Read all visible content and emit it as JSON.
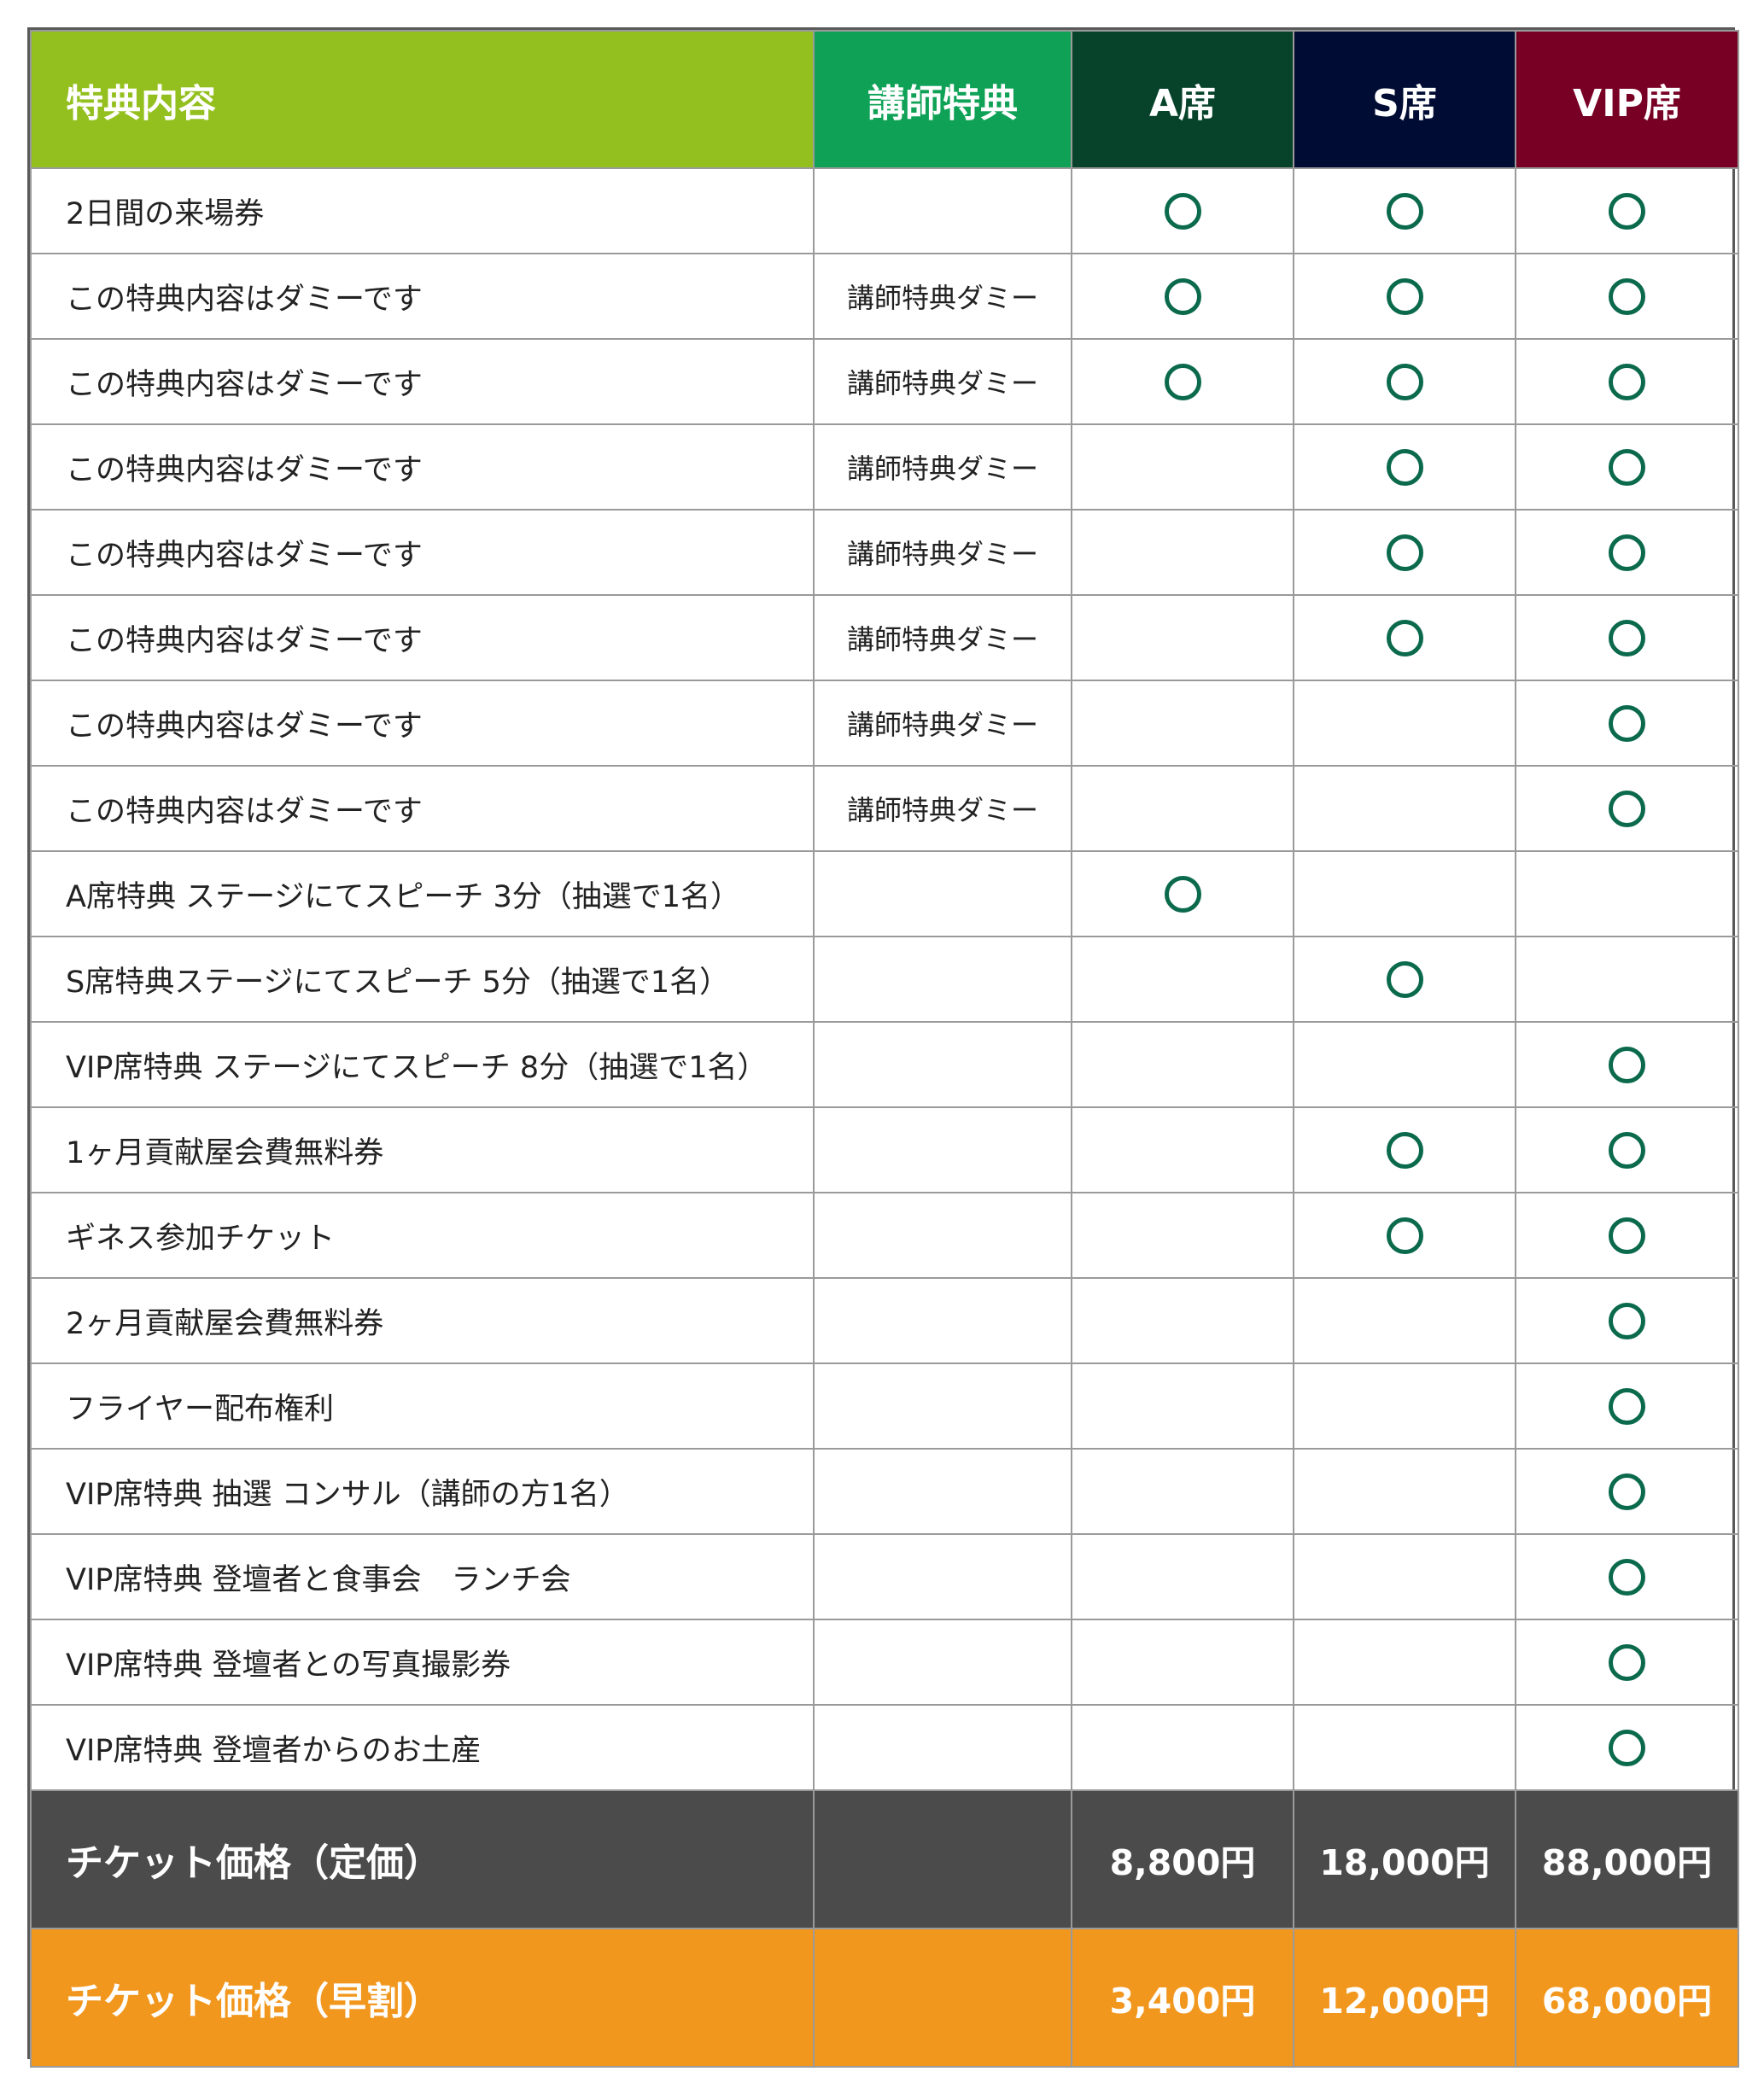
{
  "header": {
    "features": "特典内容",
    "instructor": "講師特典",
    "seat_a": "A席",
    "seat_s": "S席",
    "seat_vip": "VIP席"
  },
  "mark_symbol": "circle-mark",
  "colors": {
    "header_features": "#94c01f",
    "header_instructor": "#0fa257",
    "header_a": "#07432b",
    "header_s": "#000c33",
    "header_vip": "#790025",
    "circle": "#0b6a4c",
    "price_regular_bg": "#4b4b4b",
    "price_early_bg": "#f2971e"
  },
  "rows": [
    {
      "feature": "2日間の来場券",
      "instructor": "",
      "a": true,
      "s": true,
      "vip": true
    },
    {
      "feature": "この特典内容はダミーです",
      "instructor": "講師特典ダミー",
      "a": true,
      "s": true,
      "vip": true
    },
    {
      "feature": "この特典内容はダミーです",
      "instructor": "講師特典ダミー",
      "a": true,
      "s": true,
      "vip": true
    },
    {
      "feature": "この特典内容はダミーです",
      "instructor": "講師特典ダミー",
      "a": false,
      "s": true,
      "vip": true
    },
    {
      "feature": "この特典内容はダミーです",
      "instructor": "講師特典ダミー",
      "a": false,
      "s": true,
      "vip": true
    },
    {
      "feature": "この特典内容はダミーです",
      "instructor": "講師特典ダミー",
      "a": false,
      "s": true,
      "vip": true
    },
    {
      "feature": "この特典内容はダミーです",
      "instructor": "講師特典ダミー",
      "a": false,
      "s": false,
      "vip": true
    },
    {
      "feature": "この特典内容はダミーです",
      "instructor": "講師特典ダミー",
      "a": false,
      "s": false,
      "vip": true
    },
    {
      "feature": "A席特典 ステージにてスピーチ 3分（抽選で1名）",
      "instructor": "",
      "a": true,
      "s": false,
      "vip": false
    },
    {
      "feature": "S席特典ステージにてスピーチ 5分（抽選で1名）",
      "instructor": "",
      "a": false,
      "s": true,
      "vip": false
    },
    {
      "feature": "VIP席特典 ステージにてスピーチ 8分（抽選で1名）",
      "instructor": "",
      "a": false,
      "s": false,
      "vip": true
    },
    {
      "feature": "1ヶ月貢献屋会費無料券",
      "instructor": "",
      "a": false,
      "s": true,
      "vip": true
    },
    {
      "feature": "ギネス参加チケット",
      "instructor": "",
      "a": false,
      "s": true,
      "vip": true
    },
    {
      "feature": "2ヶ月貢献屋会費無料券",
      "instructor": "",
      "a": false,
      "s": false,
      "vip": true
    },
    {
      "feature": "フライヤー配布権利",
      "instructor": "",
      "a": false,
      "s": false,
      "vip": true
    },
    {
      "feature": "VIP席特典 抽選 コンサル（講師の方1名）",
      "instructor": "",
      "a": false,
      "s": false,
      "vip": true
    },
    {
      "feature": "VIP席特典 登壇者と食事会　ランチ会",
      "instructor": "",
      "a": false,
      "s": false,
      "vip": true
    },
    {
      "feature": "VIP席特典 登壇者との写真撮影券",
      "instructor": "",
      "a": false,
      "s": false,
      "vip": true
    },
    {
      "feature": "VIP席特典 登壇者からのお土産",
      "instructor": "",
      "a": false,
      "s": false,
      "vip": true
    }
  ],
  "prices": {
    "regular": {
      "label": "チケット価格（定価）",
      "a": "8,800円",
      "s": "18,000円",
      "vip": "88,000円"
    },
    "early": {
      "label": "チケット価格（早割）",
      "a": "3,400円",
      "s": "12,000円",
      "vip": "68,000円"
    }
  }
}
